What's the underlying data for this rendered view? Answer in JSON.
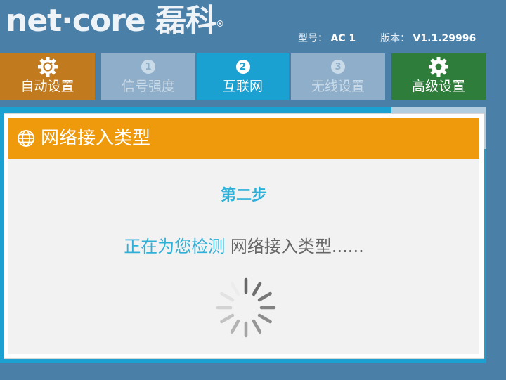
{
  "brand": {
    "logo_text": "net·core 磊科",
    "registered": "®"
  },
  "model": {
    "model_label": "型号：",
    "model_value": "AC 1",
    "version_label": "版本：",
    "version_value": "V1.1.29996"
  },
  "nav": [
    {
      "label": "自动设置",
      "icon": "gear-refresh-icon"
    },
    {
      "label": "信号强度",
      "number": "1"
    },
    {
      "label": "互联网",
      "number": "2"
    },
    {
      "label": "无线设置",
      "number": "3"
    },
    {
      "label": "高级设置",
      "icon": "gear-icon"
    }
  ],
  "dialog": {
    "title": "网络接入类型",
    "step": "第二步",
    "detect_prefix": "正在为您检测",
    "detect_text": " 网络接入类型......"
  },
  "colors": {
    "background": "#4a7fa8",
    "auto_tab": "#c27a1f",
    "active_tab": "#1aa0d1",
    "inactive_tab": "#8faec9",
    "advanced_tab": "#2f7d3a",
    "dialog_header": "#ef9a0c",
    "accent_text": "#2fb0d8"
  }
}
